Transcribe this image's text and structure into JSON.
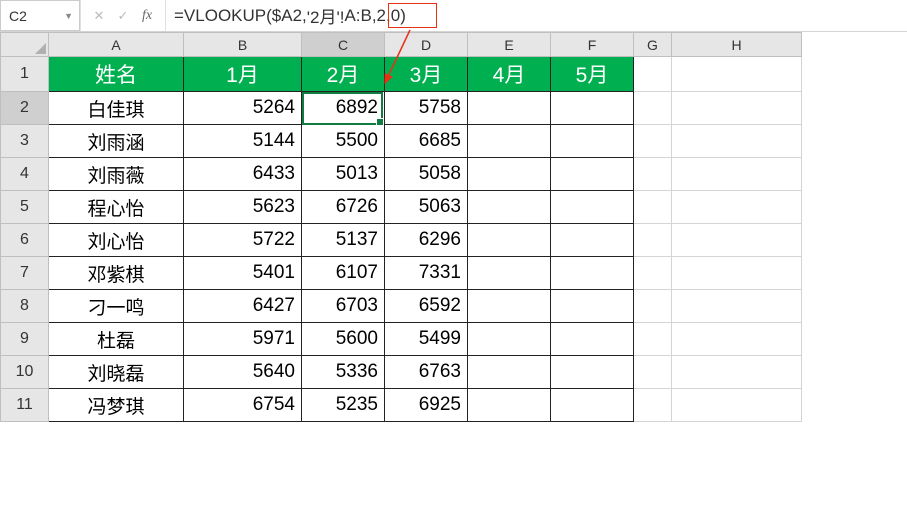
{
  "name_box": "C2",
  "formula_prefix": "=VLOOKUP($A2,",
  "formula_highlight": "'2月'!",
  "formula_suffix": "A:B,2,0)",
  "columns": [
    "A",
    "B",
    "C",
    "D",
    "E",
    "F",
    "G",
    "H"
  ],
  "chart_data": {
    "type": "table",
    "headers": [
      "姓名",
      "1月",
      "2月",
      "3月",
      "4月",
      "5月"
    ],
    "rows": [
      {
        "name": "白佳琪",
        "m1": "5264",
        "m2": "6892",
        "m3": "5758",
        "m4": "",
        "m5": ""
      },
      {
        "name": "刘雨涵",
        "m1": "5144",
        "m2": "5500",
        "m3": "6685",
        "m4": "",
        "m5": ""
      },
      {
        "name": "刘雨薇",
        "m1": "6433",
        "m2": "5013",
        "m3": "5058",
        "m4": "",
        "m5": ""
      },
      {
        "name": "程心怡",
        "m1": "5623",
        "m2": "6726",
        "m3": "5063",
        "m4": "",
        "m5": ""
      },
      {
        "name": "刘心怡",
        "m1": "5722",
        "m2": "5137",
        "m3": "6296",
        "m4": "",
        "m5": ""
      },
      {
        "name": "邓紫棋",
        "m1": "5401",
        "m2": "6107",
        "m3": "7331",
        "m4": "",
        "m5": ""
      },
      {
        "name": "刁一鸣",
        "m1": "6427",
        "m2": "6703",
        "m3": "6592",
        "m4": "",
        "m5": ""
      },
      {
        "name": "杜磊",
        "m1": "5971",
        "m2": "5600",
        "m3": "5499",
        "m4": "",
        "m5": ""
      },
      {
        "name": "刘晓磊",
        "m1": "5640",
        "m2": "5336",
        "m3": "6763",
        "m4": "",
        "m5": ""
      },
      {
        "name": "冯梦琪",
        "m1": "6754",
        "m2": "5235",
        "m3": "6925",
        "m4": "",
        "m5": ""
      }
    ]
  },
  "row_numbers": [
    "1",
    "2",
    "3",
    "4",
    "5",
    "6",
    "7",
    "8",
    "9",
    "10",
    "11"
  ]
}
